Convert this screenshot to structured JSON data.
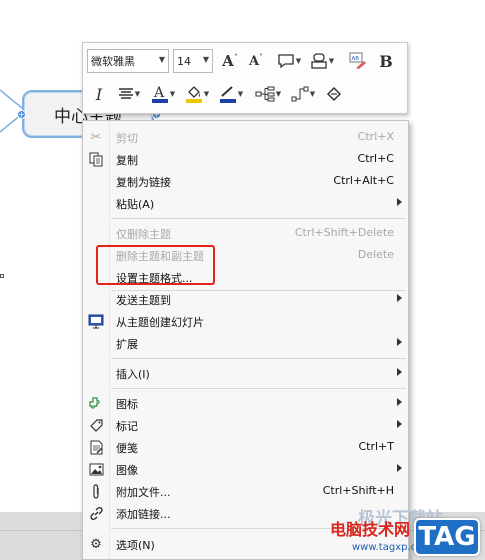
{
  "canvas": {
    "central_topic": "中心主题"
  },
  "toolbar": {
    "font_family": "微软雅黑",
    "font_size": "14",
    "icons": [
      "font-grow-icon",
      "font-shrink-icon",
      "shape-icon",
      "topic-style-icon",
      "clear-format-icon",
      "bold-icon",
      "italic-icon",
      "align-icon",
      "font-color-icon",
      "fill-color-icon",
      "line-color-icon",
      "structure-icon",
      "line-style-icon",
      "format-painter-icon"
    ],
    "bold": "B",
    "italic": "I",
    "grow": "A",
    "shrink": "A",
    "font_color_letter": "A"
  },
  "menu": {
    "cut": {
      "label": "剪切",
      "shortcut": "Ctrl+X"
    },
    "copy": {
      "label": "复制",
      "shortcut": "Ctrl+C"
    },
    "copy_as_link": {
      "label": "复制为链接",
      "shortcut": "Ctrl+Alt+C"
    },
    "paste": {
      "label": "粘贴(A)"
    },
    "delete_topic_only": {
      "label": "仅删除主题",
      "shortcut": "Ctrl+Shift+Delete"
    },
    "delete_topic_sub": {
      "label": "删除主题和副主题",
      "shortcut": "Delete"
    },
    "format_topic": {
      "label": "设置主题格式..."
    },
    "send_topic": {
      "label": "发送主题到"
    },
    "create_slide": {
      "label": "从主题创建幻灯片"
    },
    "extend": {
      "label": "扩展"
    },
    "insert": {
      "label": "插入(I)"
    },
    "icon": {
      "label": "图标"
    },
    "marker": {
      "label": "标记"
    },
    "note": {
      "label": "便笺",
      "shortcut": "Ctrl+T"
    },
    "image": {
      "label": "图像"
    },
    "attach_file": {
      "label": "附加文件...",
      "shortcut": "Ctrl+Shift+H"
    },
    "add_link": {
      "label": "添加链接..."
    },
    "options": {
      "label": "选项(N)"
    }
  },
  "colors": {
    "highlight_box": "#e3221b",
    "topic_border": "#7fb0df",
    "font_color_bar": "#1c3fa8",
    "fill_color_bar": "#f2c500",
    "line_color_bar": "#1c3fa8"
  },
  "watermark": {
    "text": "电脑技术网",
    "url": "www.tagxp.com",
    "tag": "TAG",
    "back_text": "极光下载站"
  }
}
